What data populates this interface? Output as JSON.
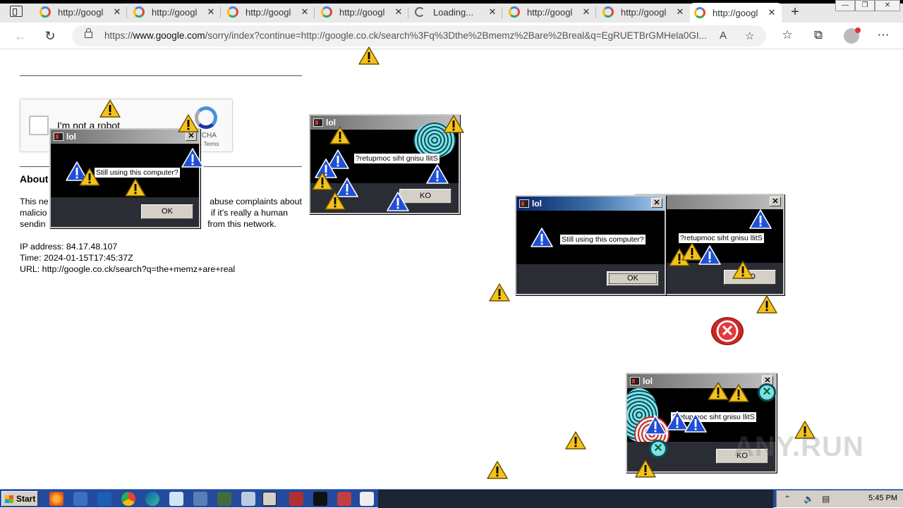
{
  "browser": {
    "tabs": [
      {
        "title": "http://googl",
        "state": "normal"
      },
      {
        "title": "http://googl",
        "state": "normal"
      },
      {
        "title": "http://googl",
        "state": "normal"
      },
      {
        "title": "http://googl",
        "state": "normal"
      },
      {
        "title": "Loading...",
        "state": "loading"
      },
      {
        "title": "http://googl",
        "state": "normal"
      },
      {
        "title": "http://googl",
        "state": "normal"
      },
      {
        "title": "http://googl",
        "state": "active"
      }
    ],
    "address_prefix": "https://",
    "address_host": "www.google.com",
    "address_rest": "/sorry/index?continue=http://google.co.ck/search%3Fq%3Dthe%2Bmemz%2Bare%2Breal&q=EgRUETBrGMHela0GI..."
  },
  "page": {
    "checkbox_label": "I'm not a robot",
    "recaptcha_brand": "PTCHA",
    "recaptcha_terms": "r - Terms",
    "about_heading": "About",
    "paragraph_lines": [
      "This ne",
      "malicio",
      "sendin"
    ],
    "paragraph_right_lines": [
      "abuse complaints about",
      "if it's really a human",
      "from this network."
    ],
    "ip_line": "IP address: 84.17.48.107",
    "time_line": "Time: 2024-01-15T17:45:37Z",
    "url_line": "URL: http://google.co.ck/search?q=the+memz+are+real"
  },
  "dialogs": [
    {
      "title": "lol",
      "message": "Still using this computer?",
      "button": "OK"
    },
    {
      "title": "",
      "message": "?retupmoc siht gnisu llitS",
      "button": "KO"
    },
    {
      "title": "lol",
      "message": "Still using this computer?",
      "button": "OK"
    },
    {
      "title": "",
      "message": "?retupmoc siht gnisu llitS",
      "button": "KO"
    },
    {
      "title": "lol",
      "message": "?retupmoc siht gnisu llitS",
      "button": "KO"
    }
  ],
  "taskbar": {
    "start_label": "Start",
    "clock": "5:45 PM"
  },
  "watermark": "ANY.RUN",
  "colors": {
    "warning_yellow": "#f4c21b",
    "info_blue": "#1f4fd8",
    "taskbar_blue": "#244a9e"
  },
  "icons": [
    "warning-icon",
    "info-icon",
    "error-icon",
    "search-icon",
    "refresh-icon",
    "back-icon",
    "lock-icon"
  ]
}
